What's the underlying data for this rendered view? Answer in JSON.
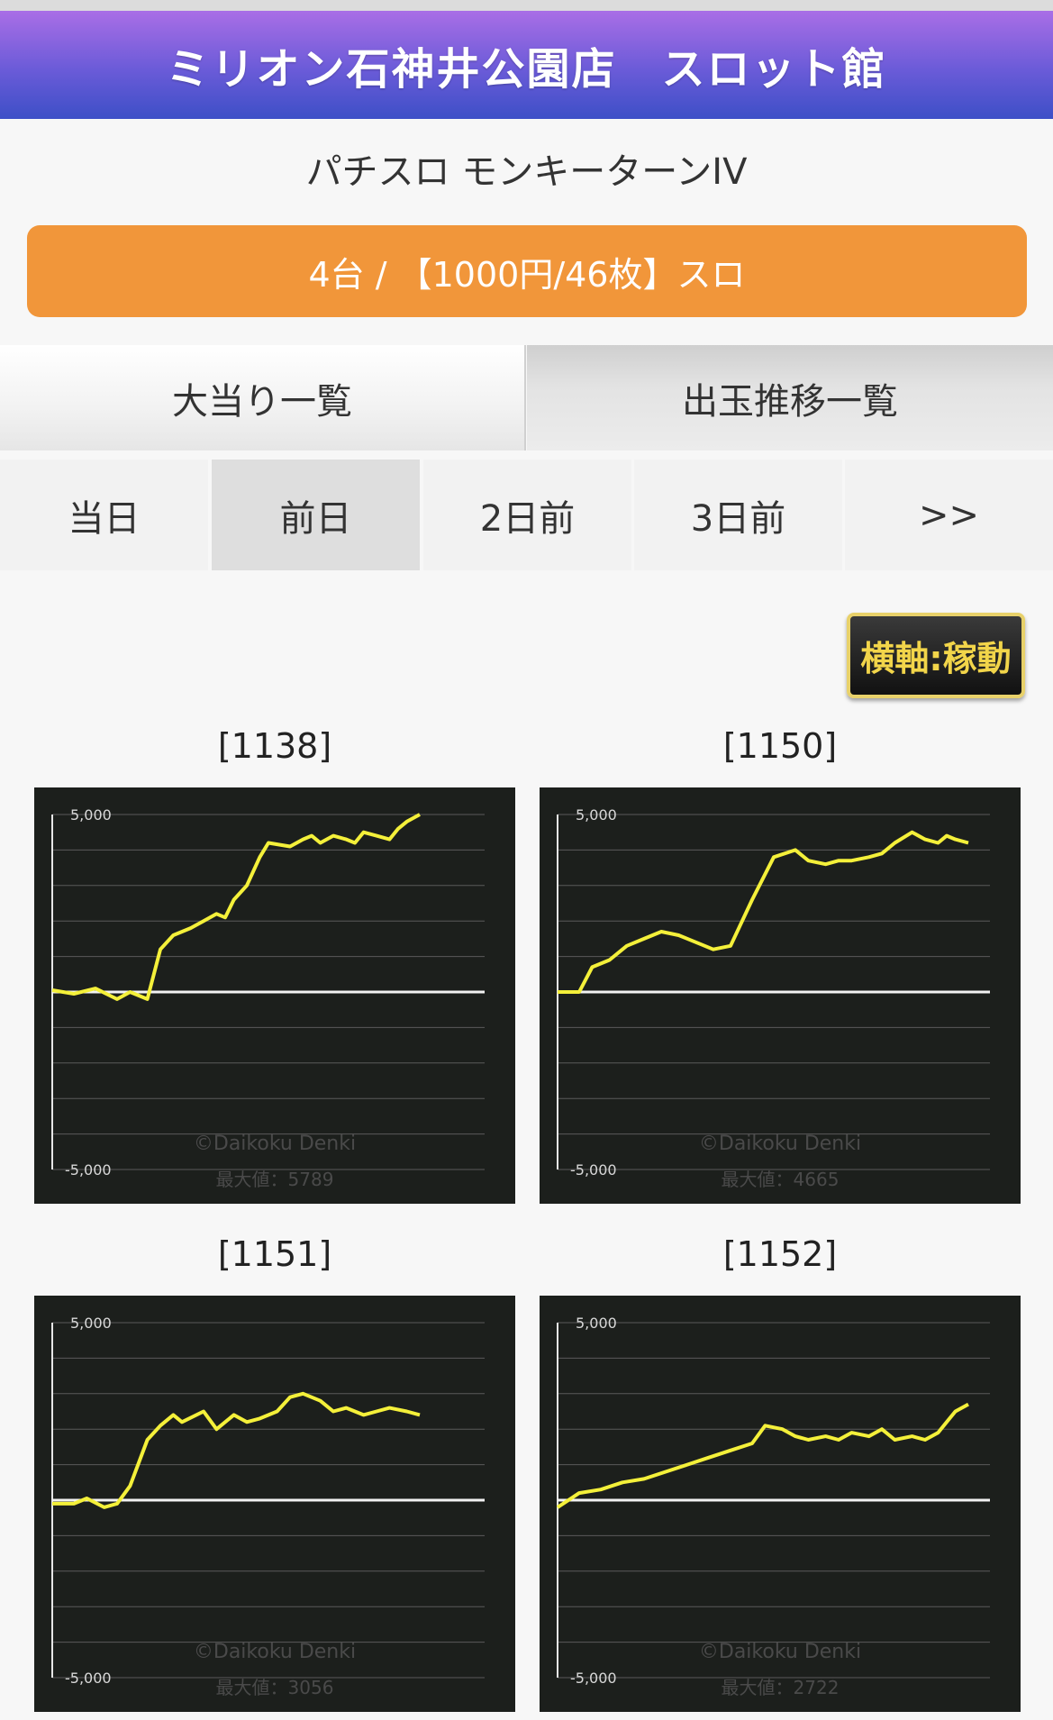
{
  "header": {
    "title": "ミリオン石神井公園店　スロット館"
  },
  "machine": {
    "name": "パチスロ モンキーターンIV",
    "info": "4台 / 【1000円/46枚】スロ"
  },
  "main_tabs": [
    {
      "label": "大当り一覧"
    },
    {
      "label": "出玉推移一覧"
    }
  ],
  "day_tabs": [
    {
      "label": "当日"
    },
    {
      "label": "前日"
    },
    {
      "label": "2日前"
    },
    {
      "label": "3日前"
    },
    {
      "label": ">>"
    }
  ],
  "selected_day": "前日",
  "axis_button": {
    "label": "横軸:稼動"
  },
  "colors": {
    "line": "#f4f03a",
    "header_top": "#a96ee6",
    "header_bottom": "#3d4fc7",
    "orange": "#f1963a"
  },
  "chart_data": [
    {
      "type": "line",
      "label": "[1138]",
      "axis_top_label": "5,000",
      "axis_bottom_label": "-5,000",
      "watermark": "©Daikoku Denki",
      "max_text": "最大値：5789",
      "ylim": [
        -5000,
        5000
      ],
      "x": [
        0,
        5,
        10,
        15,
        18,
        22,
        25,
        28,
        32,
        35,
        38,
        40,
        42,
        45,
        48,
        50,
        55,
        58,
        60,
        62,
        65,
        68,
        70,
        72,
        75,
        78,
        80,
        82,
        85
      ],
      "y": [
        50,
        -50,
        100,
        -200,
        0,
        -200,
        1200,
        1600,
        1800,
        2000,
        2200,
        2100,
        2600,
        3000,
        3800,
        4200,
        4100,
        4300,
        4400,
        4200,
        4400,
        4300,
        4200,
        4500,
        4400,
        4300,
        4600,
        4800,
        5000
      ]
    },
    {
      "type": "line",
      "label": "[1150]",
      "axis_top_label": "5,000",
      "axis_bottom_label": "-5,000",
      "watermark": "©Daikoku Denki",
      "max_text": "最大値：4665",
      "ylim": [
        -5000,
        5000
      ],
      "x": [
        0,
        5,
        8,
        12,
        16,
        20,
        24,
        28,
        32,
        36,
        40,
        45,
        50,
        55,
        58,
        62,
        65,
        68,
        72,
        75,
        78,
        82,
        85,
        88,
        90,
        92,
        95
      ],
      "y": [
        0,
        0,
        700,
        900,
        1300,
        1500,
        1700,
        1600,
        1400,
        1200,
        1300,
        2600,
        3800,
        4000,
        3700,
        3600,
        3700,
        3700,
        3800,
        3900,
        4200,
        4500,
        4300,
        4200,
        4400,
        4300,
        4200
      ]
    },
    {
      "type": "line",
      "label": "[1151]",
      "axis_top_label": "5,000",
      "axis_bottom_label": "-5,000",
      "watermark": "©Daikoku Denki",
      "max_text": "最大値：3056",
      "ylim": [
        -5000,
        5000
      ],
      "x": [
        0,
        5,
        8,
        12,
        15,
        18,
        22,
        25,
        28,
        30,
        35,
        38,
        42,
        45,
        48,
        52,
        55,
        58,
        62,
        65,
        68,
        72,
        75,
        78,
        82,
        85
      ],
      "y": [
        -100,
        -100,
        50,
        -200,
        -100,
        400,
        1700,
        2100,
        2400,
        2200,
        2500,
        2000,
        2400,
        2200,
        2300,
        2500,
        2900,
        3000,
        2800,
        2500,
        2600,
        2400,
        2500,
        2600,
        2500,
        2400
      ]
    },
    {
      "type": "line",
      "label": "[1152]",
      "axis_top_label": "5,000",
      "axis_bottom_label": "-5,000",
      "watermark": "©Daikoku Denki",
      "max_text": "最大値：2722",
      "ylim": [
        -5000,
        5000
      ],
      "x": [
        0,
        5,
        10,
        15,
        20,
        25,
        30,
        35,
        40,
        45,
        48,
        52,
        55,
        58,
        62,
        65,
        68,
        72,
        75,
        78,
        82,
        85,
        88,
        90,
        92,
        95
      ],
      "y": [
        -200,
        200,
        300,
        500,
        600,
        800,
        1000,
        1200,
        1400,
        1600,
        2100,
        2000,
        1800,
        1700,
        1800,
        1700,
        1900,
        1800,
        2000,
        1700,
        1800,
        1700,
        1900,
        2200,
        2500,
        2700
      ]
    }
  ]
}
